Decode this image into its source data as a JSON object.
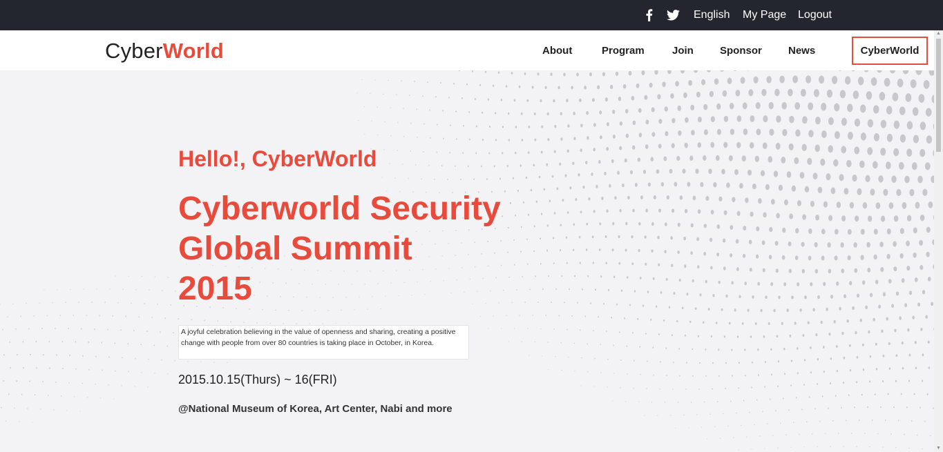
{
  "topbar": {
    "facebook_icon": "facebook-icon",
    "twitter_icon": "twitter-icon",
    "language": "English",
    "my_page": "My Page",
    "logout": "Logout"
  },
  "header": {
    "logo_prefix": "Cyber",
    "logo_accent": "World",
    "nav": [
      {
        "label": "About"
      },
      {
        "label": "Program"
      },
      {
        "label": "Join"
      },
      {
        "label": "Sponsor"
      },
      {
        "label": "News"
      },
      {
        "label": "CyberWorld",
        "active": true
      }
    ]
  },
  "hero": {
    "greeting": "Hello!, CyberWorld",
    "title_lines": [
      "Cyberworld Security",
      "Global Summit",
      "2015"
    ],
    "description": "A joyful celebration believing in the value of openness and sharing, creating a positive change with people from over 80 countries is taking place in October, in Korea.",
    "dates": "2015.10.15(Thurs) ~ 16(FRI)",
    "venue": "@National Museum of Korea, Art Center, Nabi and more"
  },
  "colors": {
    "accent": "#e84b3c",
    "topbar_bg": "#23262e",
    "hero_bg": "#f3f3f5",
    "dots": "#c8c8cc"
  }
}
